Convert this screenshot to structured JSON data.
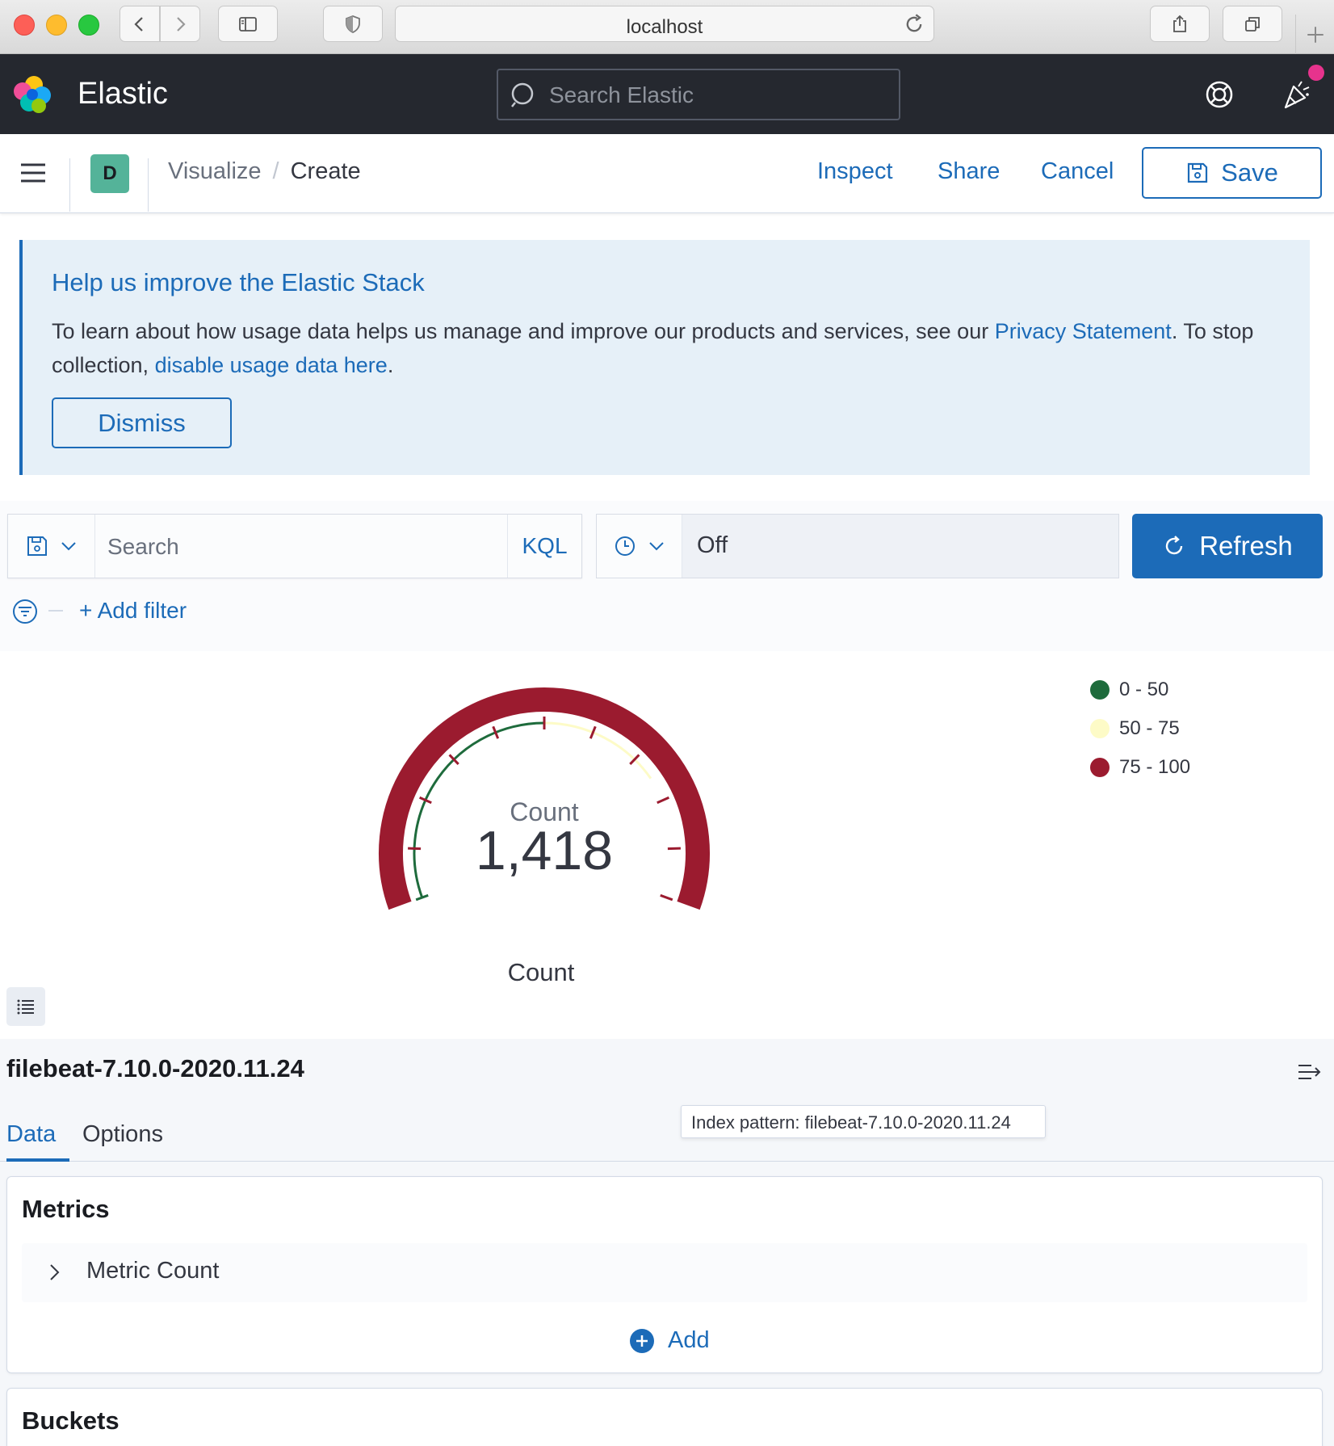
{
  "browser": {
    "url": "localhost"
  },
  "header": {
    "brand": "Elastic",
    "search_placeholder": "Search Elastic",
    "notification_color": "#e7338d"
  },
  "toolbar": {
    "space_initial": "D",
    "breadcrumbs": [
      "Visualize",
      "Create"
    ],
    "breadcrumb_separator": "/",
    "inspect_label": "Inspect",
    "share_label": "Share",
    "cancel_label": "Cancel",
    "save_label": "Save"
  },
  "callout": {
    "title": "Help us improve the Elastic Stack",
    "text_1": "To learn about how usage data helps us manage and improve our products and services, see our ",
    "privacy_link": "Privacy Statement",
    "text_2": ". To stop collection, ",
    "disable_link": "disable usage data here",
    "text_3": ".",
    "dismiss_label": "Dismiss"
  },
  "query": {
    "search_placeholder": "Search",
    "language": "KQL",
    "refresh_interval": "Off",
    "refresh_label": "Refresh",
    "add_filter_label": "+ Add filter"
  },
  "visualization": {
    "type": "gauge",
    "metric_label": "Count",
    "value": 1418,
    "value_display": "1,418",
    "gauge_max": 100,
    "ranges": [
      {
        "label": "0 - 50",
        "from": 0,
        "to": 50,
        "color": "#1e6b3c"
      },
      {
        "label": "50 - 75",
        "from": 50,
        "to": 75,
        "color": "#fdfbc7"
      },
      {
        "label": "75 - 100",
        "from": 75,
        "to": 100,
        "color": "#9b1b2f"
      }
    ],
    "axis_label": "Count"
  },
  "editor": {
    "index_pattern": "filebeat-7.10.0-2020.11.24",
    "tooltip": "Index pattern: filebeat-7.10.0-2020.11.24",
    "tabs": [
      "Data",
      "Options"
    ],
    "active_tab": "Data",
    "metrics_title": "Metrics",
    "metric_item": "Metric Count",
    "add_label": "Add",
    "buckets_title": "Buckets"
  }
}
